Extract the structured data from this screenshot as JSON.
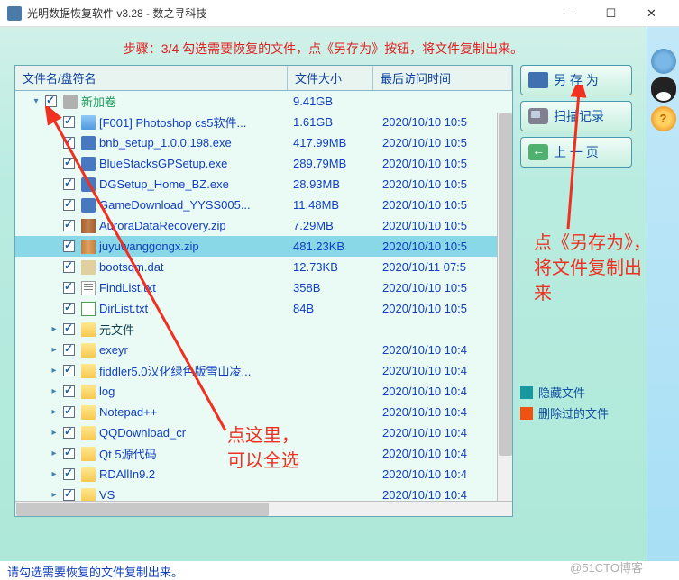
{
  "window": {
    "title": "光明数据恢复软件 v3.28 - 数之寻科技"
  },
  "step": "步骤：3/4 勾选需要恢复的文件，点《另存为》按钮，将文件复制出来。",
  "columns": {
    "name": "文件名/盘符名",
    "size": "文件大小",
    "time": "最后访问时间"
  },
  "rows": [
    {
      "indent": 0,
      "exp": "▾",
      "chk": true,
      "icon": "disk",
      "name": "新加卷",
      "cls": "green",
      "size": "9.41GB",
      "time": "",
      "sel": false
    },
    {
      "indent": 1,
      "exp": "",
      "chk": true,
      "icon": "folder-blue",
      "name": "[F001] Photoshop cs5软件...",
      "cls": "link",
      "size": "1.61GB",
      "time": "2020/10/10 10:5",
      "sel": false
    },
    {
      "indent": 1,
      "exp": "",
      "chk": true,
      "icon": "exe",
      "name": "bnb_setup_1.0.0.198.exe",
      "cls": "link",
      "size": "417.99MB",
      "time": "2020/10/10 10:5",
      "sel": false
    },
    {
      "indent": 1,
      "exp": "",
      "chk": true,
      "icon": "exe",
      "name": "BlueStacksGPSetup.exe",
      "cls": "link",
      "size": "289.79MB",
      "time": "2020/10/10 10:5",
      "sel": false
    },
    {
      "indent": 1,
      "exp": "",
      "chk": true,
      "icon": "exe",
      "name": "DGSetup_Home_BZ.exe",
      "cls": "link",
      "size": "28.93MB",
      "time": "2020/10/10 10:5",
      "sel": false
    },
    {
      "indent": 1,
      "exp": "",
      "chk": true,
      "icon": "exe",
      "name": "GameDownload_YYSS005...",
      "cls": "link",
      "size": "11.48MB",
      "time": "2020/10/10 10:5",
      "sel": false
    },
    {
      "indent": 1,
      "exp": "",
      "chk": true,
      "icon": "zip2",
      "name": "AuroraDataRecovery.zip",
      "cls": "link",
      "size": "7.29MB",
      "time": "2020/10/10 10:5",
      "sel": false
    },
    {
      "indent": 1,
      "exp": "",
      "chk": true,
      "icon": "zip",
      "name": "juyuwanggongx.zip",
      "cls": "link",
      "size": "481.23KB",
      "time": "2020/10/10 10:5",
      "sel": true
    },
    {
      "indent": 1,
      "exp": "",
      "chk": true,
      "icon": "dat",
      "name": "bootsqm.dat",
      "cls": "link",
      "size": "12.73KB",
      "time": "2020/10/11 07:5",
      "sel": false
    },
    {
      "indent": 1,
      "exp": "",
      "chk": true,
      "icon": "txt",
      "name": "FindList.txt",
      "cls": "link",
      "size": "358B",
      "time": "2020/10/10 10:5",
      "sel": false
    },
    {
      "indent": 1,
      "exp": "",
      "chk": true,
      "icon": "txt2",
      "name": "DirList.txt",
      "cls": "link",
      "size": "84B",
      "time": "2020/10/10 10:5",
      "sel": false
    },
    {
      "indent": 1,
      "exp": "▸",
      "chk": true,
      "icon": "folder",
      "name": "元文件",
      "cls": "normal",
      "size": "",
      "time": "",
      "sel": false
    },
    {
      "indent": 1,
      "exp": "▸",
      "chk": true,
      "icon": "folder",
      "name": "exeyr",
      "cls": "link",
      "size": "",
      "time": "2020/10/10 10:4",
      "sel": false
    },
    {
      "indent": 1,
      "exp": "▸",
      "chk": true,
      "icon": "folder",
      "name": "fiddler5.0汉化绿色版雪山凌...",
      "cls": "link",
      "size": "",
      "time": "2020/10/10 10:4",
      "sel": false
    },
    {
      "indent": 1,
      "exp": "▸",
      "chk": true,
      "icon": "folder",
      "name": "log",
      "cls": "link",
      "size": "",
      "time": "2020/10/10 10:4",
      "sel": false
    },
    {
      "indent": 1,
      "exp": "▸",
      "chk": true,
      "icon": "folder",
      "name": "Notepad++",
      "cls": "link",
      "size": "",
      "time": "2020/10/10 10:4",
      "sel": false
    },
    {
      "indent": 1,
      "exp": "▸",
      "chk": true,
      "icon": "folder",
      "name": "QQDownload_cr",
      "cls": "link",
      "size": "",
      "time": "2020/10/10 10:4",
      "sel": false
    },
    {
      "indent": 1,
      "exp": "▸",
      "chk": true,
      "icon": "folder",
      "name": "Qt 5源代码",
      "cls": "link",
      "size": "",
      "time": "2020/10/10 10:4",
      "sel": false
    },
    {
      "indent": 1,
      "exp": "▸",
      "chk": true,
      "icon": "folder",
      "name": "RDAllIn9.2",
      "cls": "link",
      "size": "",
      "time": "2020/10/10 10:4",
      "sel": false
    },
    {
      "indent": 1,
      "exp": "▸",
      "chk": true,
      "icon": "folder",
      "name": "VS",
      "cls": "link",
      "size": "",
      "time": "2020/10/10 10:4",
      "sel": false
    }
  ],
  "buttons": {
    "save": "另 存 为",
    "scan": "扫描记录",
    "prev": "上 一 页"
  },
  "legend": {
    "hidden": "隐藏文件",
    "deleted": "删除过的文件"
  },
  "status": "请勾选需要恢复的文件复制出来。",
  "annotations": {
    "save": "点《另存为》，将文件复制出来",
    "select_here": "点这里，",
    "select_all": "可以全选"
  },
  "watermark": "@51CTO博客",
  "help_glyph": "?"
}
